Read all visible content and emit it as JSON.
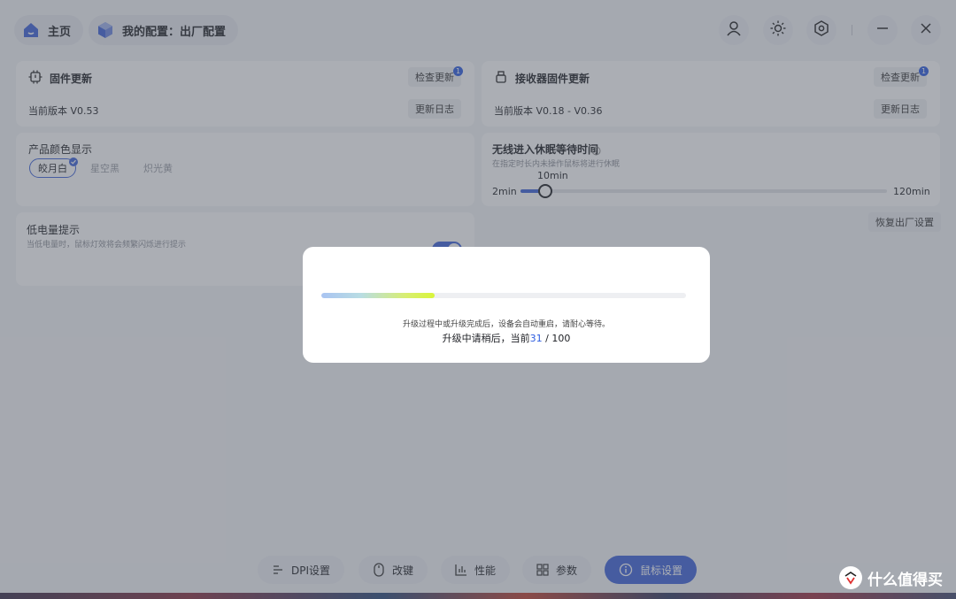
{
  "header": {
    "home_label": "主页",
    "config_label": "我的配置：出厂配置",
    "icons": [
      "user-icon",
      "brightness-icon",
      "settings-hex-icon",
      "minimize-icon",
      "close-icon"
    ]
  },
  "firmware": {
    "title": "固件更新",
    "check_label": "检查更新",
    "badge": "1",
    "version_text": "当前版本 V0.53",
    "log_label": "更新日志"
  },
  "receiver": {
    "title": "接收器固件更新",
    "check_label": "检查更新",
    "badge": "1",
    "version_text": "当前版本 V0.18 - V0.36",
    "log_label": "更新日志"
  },
  "color": {
    "title": "产品颜色显示",
    "options": [
      "皎月白",
      "星空黑",
      "炽光黄"
    ],
    "selected_index": 0
  },
  "sleep": {
    "title": "无线进入休眠等待时间",
    "desc": "在指定时长内未操作鼠标将进行休眠",
    "current": "10min",
    "min_label": "2min",
    "max_label": "120min",
    "value_min": 10,
    "range": [
      2,
      120
    ]
  },
  "battery": {
    "title": "低电量提示",
    "desc": "当低电量时，鼠标灯效将会频繁闪烁进行提示",
    "enabled": true
  },
  "reset_label": "恢复出厂设置",
  "nav": [
    {
      "label": "DPI设置",
      "icon": "dpi-icon"
    },
    {
      "label": "改键",
      "icon": "mouse-icon"
    },
    {
      "label": "性能",
      "icon": "performance-chart-icon"
    },
    {
      "label": "参数",
      "icon": "grid-icon"
    },
    {
      "label": "鼠标设置",
      "icon": "info-icon"
    }
  ],
  "modal": {
    "note": "升级过程中或升级完成后，设备会自动重启，请耐心等待。",
    "status_prefix": "升级中请稍后，当前",
    "current": "31",
    "total": "/ 100",
    "progress": 0.31
  },
  "watermark": {
    "name": "什么值得买",
    "logo_char": "值"
  },
  "colors": {
    "accent": "#3e63d9",
    "badge": "#2d5de0"
  }
}
